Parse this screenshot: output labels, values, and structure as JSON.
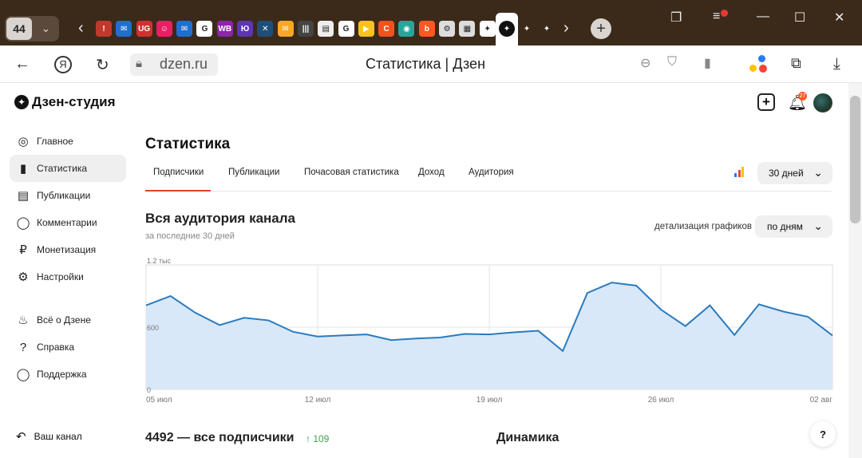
{
  "browser": {
    "tab_count": "44",
    "url": "dzen.ru",
    "title": "Статистика | Дзен",
    "colors": {
      "frame": "#3b2a1a"
    },
    "tab_icons": [
      {
        "label": "!",
        "color": "#c0392b"
      },
      {
        "label": "✉",
        "color": "#1e6fd1"
      },
      {
        "label": "UG",
        "color": "#d32f2f"
      },
      {
        "label": "☺",
        "color": "#e91e63"
      },
      {
        "label": "✉",
        "color": "#1e6fd1"
      },
      {
        "label": "G",
        "color": "#ffffff"
      },
      {
        "label": "WB",
        "color": "#8e24aa"
      },
      {
        "label": "Ю",
        "color": "#5e35b1"
      },
      {
        "label": "✕",
        "color": "#1f4e79"
      },
      {
        "label": "✉",
        "color": "#f9a825"
      },
      {
        "label": "|||",
        "color": "#444"
      },
      {
        "label": "▤",
        "color": "#eeeeee"
      },
      {
        "label": "G",
        "color": "#ffffff"
      },
      {
        "label": "▶",
        "color": "#f9c21d"
      },
      {
        "label": "C",
        "color": "#f4511e"
      },
      {
        "label": "◉",
        "color": "#26a69a"
      },
      {
        "label": "b",
        "color": "#ff5722"
      },
      {
        "label": "⚙",
        "color": "#ddd"
      },
      {
        "label": "▦",
        "color": "#ddd"
      },
      {
        "label": "✦",
        "color": "#ffffff"
      }
    ],
    "tabs_after_active": [
      "✦",
      "✦"
    ]
  },
  "studio": {
    "logo": "Дзен-студия",
    "bell_count": "27"
  },
  "sidebar": {
    "items": [
      {
        "label": "Главное",
        "icon": "planet-icon",
        "glyph": "◎"
      },
      {
        "label": "Статистика",
        "icon": "stats-icon",
        "glyph": "▮",
        "active": true
      },
      {
        "label": "Публикации",
        "icon": "publications-icon",
        "glyph": "▤"
      },
      {
        "label": "Комментарии",
        "icon": "comments-icon",
        "glyph": "◯"
      },
      {
        "label": "Монетизация",
        "icon": "ruble-icon",
        "glyph": "₽"
      },
      {
        "label": "Настройки",
        "icon": "gear-icon",
        "glyph": "⚙"
      },
      {
        "label": "Всё о Дзене",
        "icon": "flame-icon",
        "glyph": "♨"
      },
      {
        "label": "Справка",
        "icon": "question-icon",
        "glyph": "?"
      },
      {
        "label": "Поддержка",
        "icon": "chat-icon",
        "glyph": "◯"
      }
    ],
    "your_channel": "Ваш канал"
  },
  "main": {
    "title": "Статистика",
    "tabs": [
      "Подписчики",
      "Публикации",
      "Почасовая статистика",
      "Доход",
      "Аудитория"
    ],
    "period": "30 дней",
    "section_title": "Вся аудитория канала",
    "section_subtitle": "за последние 30 дней",
    "detail_label": "детализация графиков",
    "detail_value": "по дням",
    "total_subscribers": "4492 — все подписчики",
    "subscribers_delta": "↑ 109",
    "dynamics_title": "Динамика"
  },
  "chart_data": {
    "type": "area",
    "title": "",
    "xlabel": "",
    "ylabel": "",
    "y_ticks": [
      "1.2 тыс",
      "600",
      "0"
    ],
    "ylim": [
      0,
      1200
    ],
    "x_ticks": [
      "05 июл",
      "12 июл",
      "19 июл",
      "26 июл",
      "02 авг"
    ],
    "x": [
      "05 июл",
      "06 июл",
      "07 июл",
      "08 июл",
      "09 июл",
      "10 июл",
      "11 июл",
      "12 июл",
      "13 июл",
      "14 июл",
      "15 июл",
      "16 июл",
      "17 июл",
      "18 июл",
      "19 июл",
      "20 июл",
      "21 июл",
      "22 июл",
      "23 июл",
      "24 июл",
      "25 июл",
      "26 июл",
      "27 июл",
      "28 июл",
      "29 июл",
      "30 июл",
      "31 июл",
      "01 авг",
      "02 авг"
    ],
    "values": [
      810,
      900,
      740,
      620,
      690,
      665,
      555,
      510,
      520,
      530,
      475,
      490,
      500,
      535,
      530,
      550,
      565,
      370,
      930,
      1030,
      1000,
      770,
      610,
      810,
      525,
      820,
      750,
      700,
      520
    ],
    "grid": true,
    "colors": {
      "line": "#2a7bbf",
      "fill": "#d8e8f8"
    }
  }
}
